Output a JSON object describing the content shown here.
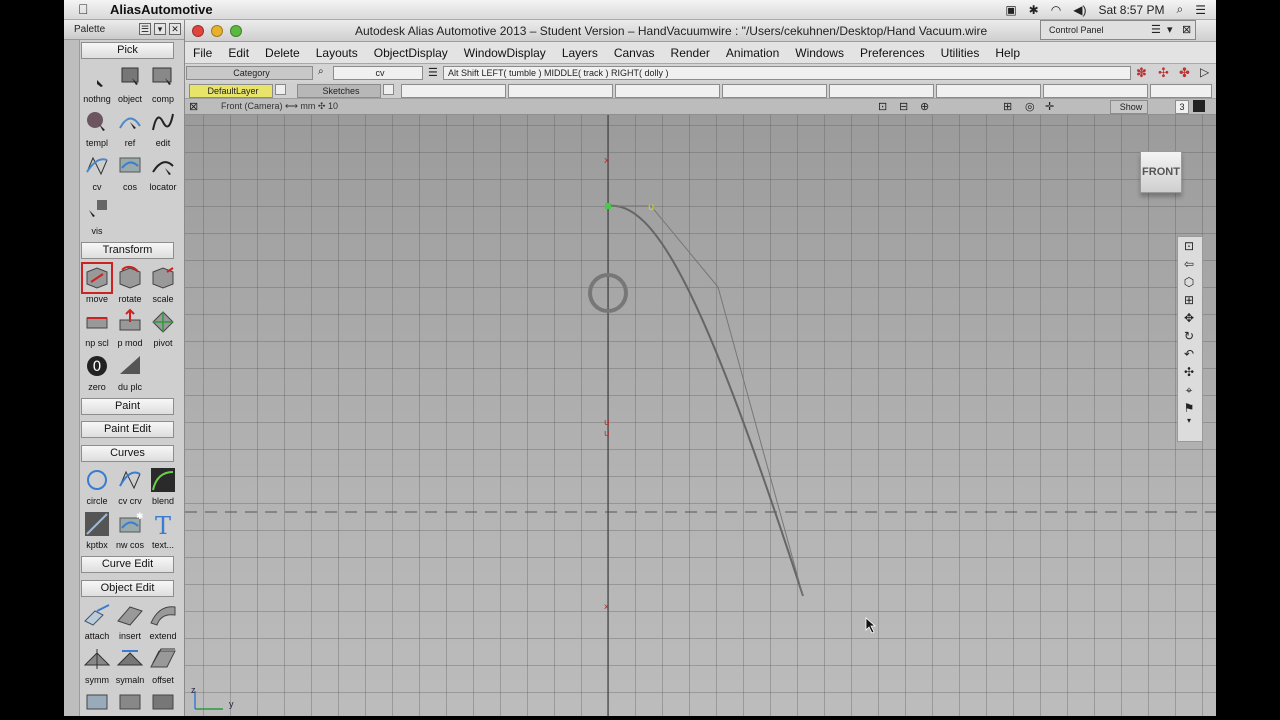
{
  "mac_menubar": {
    "app_name": "AliasAutomotive",
    "clock": "Sat 8:57 PM"
  },
  "palette": {
    "title": "Palette",
    "sections": {
      "pick": "Pick",
      "transform": "Transform",
      "paint": "Paint",
      "paint_edit": "Paint Edit",
      "curves": "Curves",
      "curve_edit": "Curve Edit",
      "object_edit": "Object Edit"
    },
    "pick_tools": [
      "nothng",
      "object",
      "comp",
      "templ",
      "ref",
      "edit",
      "cv",
      "cos",
      "locator",
      "vis"
    ],
    "transform_tools": [
      "move",
      "rotate",
      "scale",
      "np scl",
      "p mod",
      "pivot",
      "zero",
      "du plc"
    ],
    "curve_tools": [
      "circle",
      "cv crv",
      "blend",
      "kptbx",
      "nw cos",
      "text..."
    ],
    "object_edit_tools": [
      "attach",
      "insert",
      "extend",
      "symm",
      "symaln",
      "offset"
    ]
  },
  "main_window": {
    "title": "Autodesk Alias Automotive 2013 – Student Version – HandVacuumwire : \"/Users/cekuhnen/Desktop/Hand Vacuum.wire",
    "menus": [
      "File",
      "Edit",
      "Delete",
      "Layouts",
      "ObjectDisplay",
      "WindowDisplay",
      "Layers",
      "Canvas",
      "Render",
      "Animation",
      "Windows",
      "Preferences",
      "Utilities",
      "Help"
    ],
    "category_label": "Category",
    "category_value": "cv",
    "hint": "Alt Shift   LEFT( tumble )   MIDDLE( track )   RIGHT( dolly )",
    "layers": [
      "DefaultLayer",
      "Sketches"
    ],
    "view_title": "Front (Camera)  ⟷ mm   ✣ 10",
    "show_label": "Show",
    "show_count": "3",
    "view_cube_label": "FRONT",
    "axis_z": "z",
    "axis_y": "y"
  },
  "control_panel": {
    "title": "Control Panel"
  },
  "colors": {
    "selected_tool": "#cc2222",
    "default_layer": "#e8e46a",
    "canvas": "#a9a9a9"
  }
}
